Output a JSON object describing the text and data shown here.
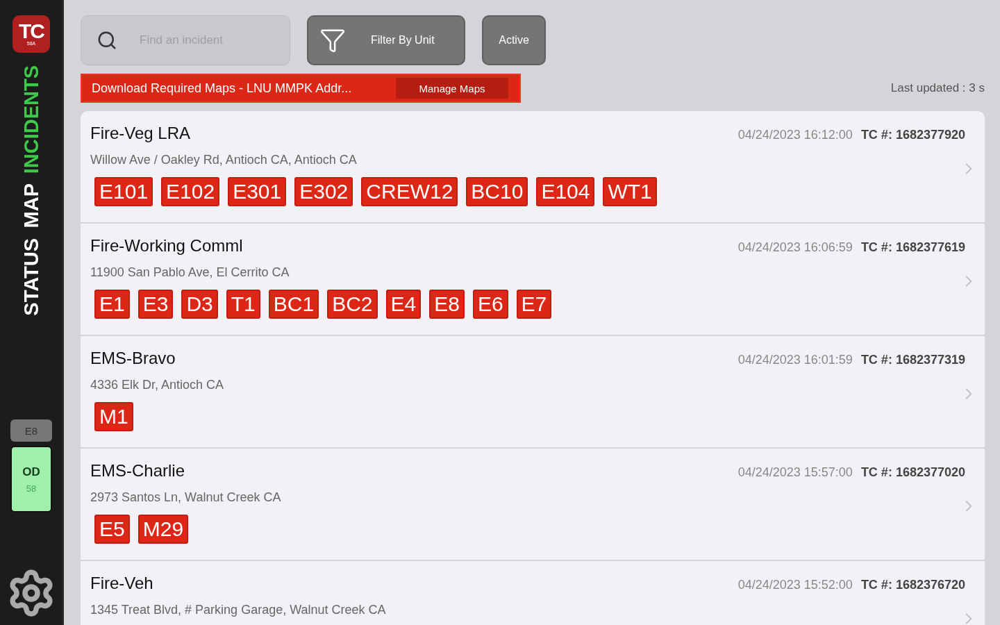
{
  "sidebar": {
    "logo": {
      "letters": "TC",
      "sub": "58A"
    },
    "tabs": [
      {
        "label": "STATUS",
        "selected": false
      },
      {
        "label": "MAP",
        "selected": false
      },
      {
        "label": "INCIDENTS",
        "selected": true
      }
    ],
    "unit": {
      "name": "E8",
      "status": "OD",
      "number": "58"
    }
  },
  "search": {
    "placeholder": "Find an incident"
  },
  "filter_button": "Filter By Unit",
  "active_button": "Active",
  "banner": {
    "text": "Download Required Maps - LNU MMPK Addr...",
    "button": "Manage Maps"
  },
  "last_updated": "Last updated : 3 s",
  "incidents": [
    {
      "type": "Fire-Veg LRA",
      "time": "04/24/2023 16:12:00",
      "tc_label": "TC #:",
      "tc": "1682377920",
      "address": "Willow Ave / Oakley Rd, Antioch CA, Antioch CA",
      "units": [
        "E101",
        "E102",
        "E301",
        "E302",
        "CREW12",
        "BC10",
        "E104",
        "WT1"
      ]
    },
    {
      "type": "Fire-Working Comml",
      "time": "04/24/2023 16:06:59",
      "tc_label": "TC #:",
      "tc": "1682377619",
      "address": "11900 San Pablo Ave, El Cerrito CA",
      "units": [
        "E1",
        "E3",
        "D3",
        "T1",
        "BC1",
        "BC2",
        "E4",
        "E8",
        "E6",
        "E7"
      ]
    },
    {
      "type": "EMS-Bravo",
      "time": "04/24/2023 16:01:59",
      "tc_label": "TC #:",
      "tc": "1682377319",
      "address": "4336 Elk Dr, Antioch CA",
      "units": [
        "M1"
      ]
    },
    {
      "type": "EMS-Charlie",
      "time": "04/24/2023 15:57:00",
      "tc_label": "TC #:",
      "tc": "1682377020",
      "address": "2973 Santos Ln, Walnut Creek CA",
      "units": [
        "E5",
        "M29"
      ]
    },
    {
      "type": "Fire-Veh",
      "time": "04/24/2023 15:52:00",
      "tc_label": "TC #:",
      "tc": "1682376720",
      "address": "1345 Treat Blvd, # Parking Garage, Walnut Creek CA"
    }
  ]
}
